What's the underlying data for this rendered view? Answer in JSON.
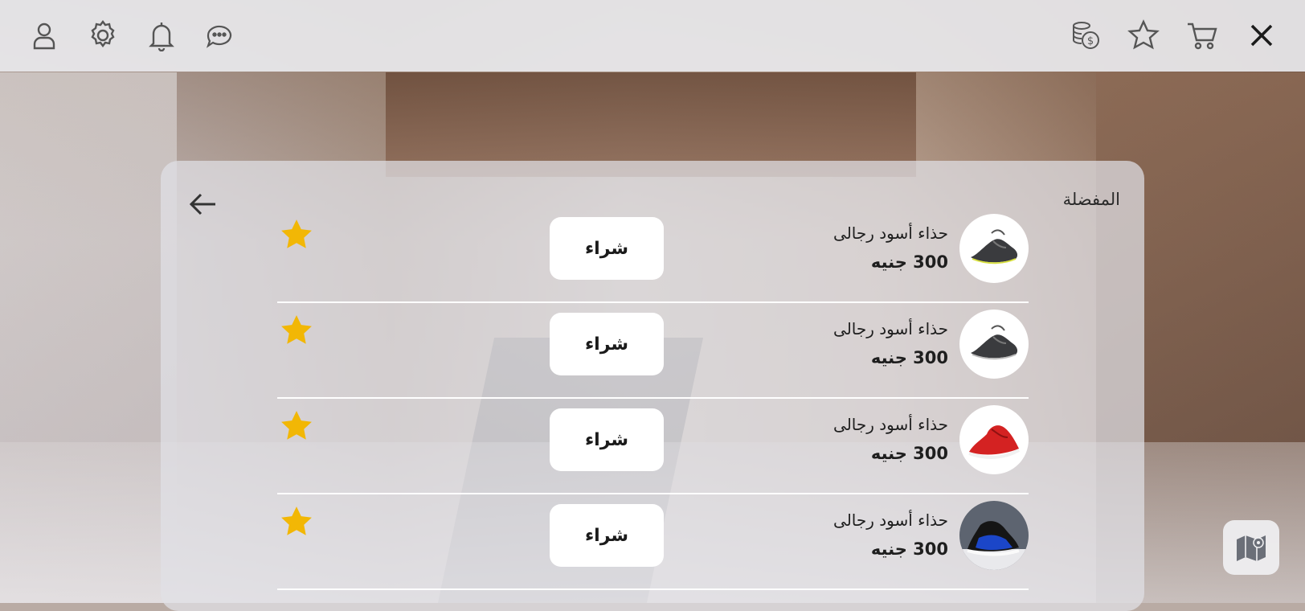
{
  "topbar": {
    "icons_left": [
      "profile-icon",
      "settings-gear-icon",
      "notifications-bell-icon",
      "chat-icon"
    ],
    "icons_right": [
      "coins-icon",
      "favorites-star-icon",
      "cart-icon",
      "close-icon"
    ]
  },
  "favorites": {
    "title": "المفضلة",
    "items": [
      {
        "name": "حذاء أسود رجالى",
        "price": "300 جنيه",
        "buy_label": "شراء",
        "image": "black-sneaker"
      },
      {
        "name": "حذاء أسود رجالى",
        "price": "300 جنيه",
        "buy_label": "شراء",
        "image": "black-sneaker"
      },
      {
        "name": "حذاء أسود رجالى",
        "price": "300 جنيه",
        "buy_label": "شراء",
        "image": "red-sneaker"
      },
      {
        "name": "حذاء أسود رجالى",
        "price": "300 جنيه",
        "buy_label": "شراء",
        "image": "blue-black-sneaker"
      }
    ]
  },
  "colors": {
    "star": "#f2b705",
    "icon": "#555555",
    "button_bg": "#ffffff"
  }
}
